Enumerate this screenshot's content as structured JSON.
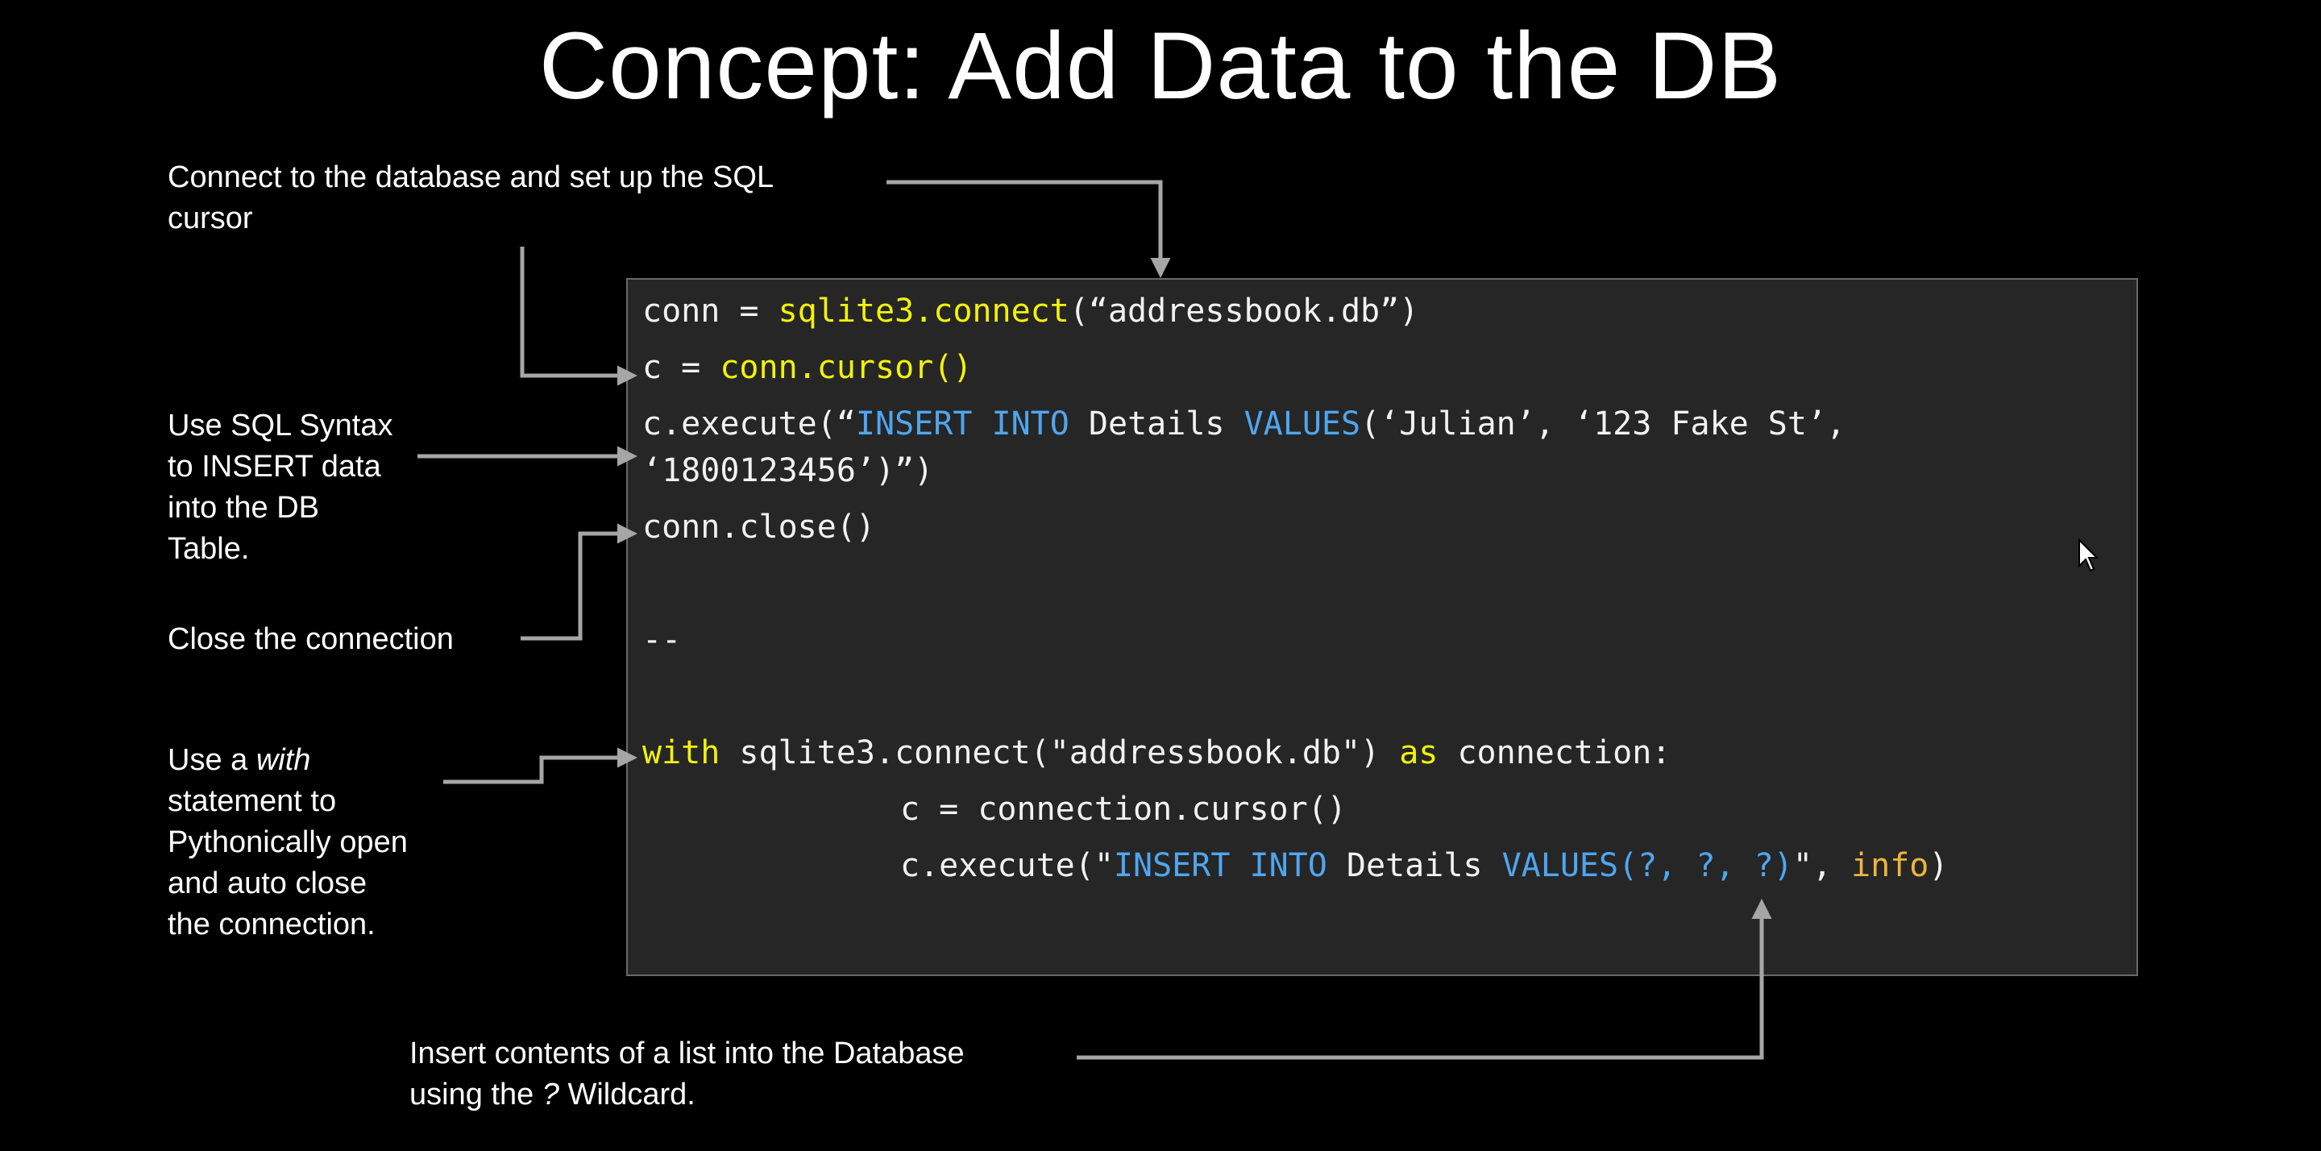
{
  "slide": {
    "title": "Concept: Add Data to the DB"
  },
  "annotations": {
    "connect": [
      "Connect to the database and set up the SQL",
      "cursor"
    ],
    "insert": [
      "Use SQL Syntax",
      "to INSERT data",
      "into the DB",
      "Table."
    ],
    "close": "Close the connection",
    "with_line1_prefix": "Use a ",
    "with_line1_italic": "with",
    "with_rest": [
      "statement to",
      "Pythonically open",
      "and auto close",
      "the connection."
    ],
    "wildcard_line1": "Insert contents of a list into the Database",
    "wildcard_line2_prefix": "using the ",
    "wildcard_line2_italic": "?",
    "wildcard_line2_suffix": " Wildcard."
  },
  "code": {
    "line1": {
      "a": "conn = ",
      "b": "sqlite3.connect",
      "c": "(“addressbook.db”)"
    },
    "line2": {
      "a": "c = ",
      "b": "conn.cursor()"
    },
    "line3": {
      "a": "c.execute(“",
      "b": "INSERT",
      "c": " ",
      "d": "INTO",
      "e": " Details ",
      "f": "VALUES",
      "g": "(‘Julian’, ‘123 Fake St’,"
    },
    "line4": "‘1800123456’)”)",
    "line5": "conn.close()",
    "separator": "--",
    "line6": {
      "a": "with",
      "b": " sqlite3.connect(\"addressbook.db\") ",
      "c": "as",
      "d": " connection:"
    },
    "line7": "c = connection.cursor()",
    "line8": {
      "a": "c.execute(\"",
      "b": "INSERT",
      "c": " ",
      "d": "INTO",
      "e": " Details ",
      "f": "VALUES(?, ?, ?)",
      "g": "\", ",
      "h": "info",
      "i": ")"
    }
  },
  "colors": {
    "background": "#000000",
    "panel": "#262626",
    "keyword_yellow": "#f2f20a",
    "sql_blue": "#4fa6f0",
    "variable_orange": "#f0b43c",
    "arrow": "#a6a6a6"
  },
  "icons": {
    "cursor": "mouse-pointer-icon"
  }
}
